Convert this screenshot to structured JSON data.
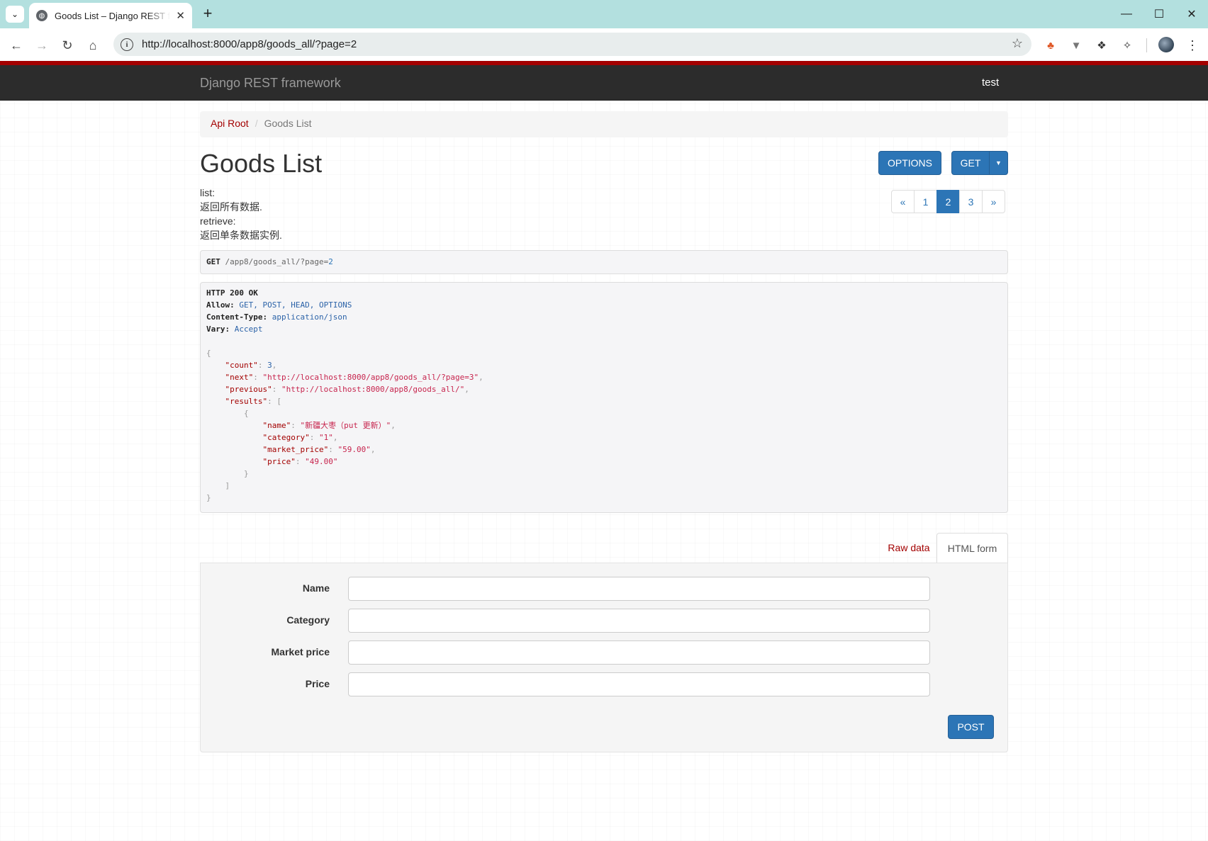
{
  "browser": {
    "tab_title": "Goods List – Django REST framework",
    "url": "http://localhost:8000/app8/goods_all/?page=2"
  },
  "navbar": {
    "brand": "Django REST framework",
    "user": "test"
  },
  "breadcrumb": {
    "root": "Api Root",
    "current": "Goods List"
  },
  "page": {
    "title": "Goods List",
    "buttons": {
      "options": "OPTIONS",
      "get": "GET"
    },
    "description": [
      "list:",
      "返回所有数据.",
      "retrieve:",
      "返回单条数据实例."
    ]
  },
  "pagination": {
    "prev": "«",
    "pages": [
      "1",
      "2",
      "3"
    ],
    "active": "2",
    "next": "»"
  },
  "request": {
    "method": "GET",
    "path": "/app8/goods_all/",
    "query_key": "?page=",
    "query_val": "2"
  },
  "response": {
    "status": "HTTP 200 OK",
    "headers": [
      {
        "key": "Allow:",
        "value": "GET, POST, HEAD, OPTIONS"
      },
      {
        "key": "Content-Type:",
        "value": "application/json"
      },
      {
        "key": "Vary:",
        "value": "Accept"
      }
    ],
    "body": {
      "count": "3",
      "next": "\"http://localhost:8000/app8/goods_all/?page=3\"",
      "previous": "\"http://localhost:8000/app8/goods_all/\"",
      "result_name": "\"新疆大枣（put 更新）\"",
      "result_category": "\"1\"",
      "result_market_price": "\"59.00\"",
      "result_price": "\"49.00\""
    }
  },
  "form": {
    "tabs": {
      "raw": "Raw data",
      "html": "HTML form"
    },
    "fields": [
      {
        "label": "Name",
        "value": ""
      },
      {
        "label": "Category",
        "value": ""
      },
      {
        "label": "Market price",
        "value": ""
      },
      {
        "label": "Price",
        "value": ""
      }
    ],
    "submit": "POST"
  }
}
